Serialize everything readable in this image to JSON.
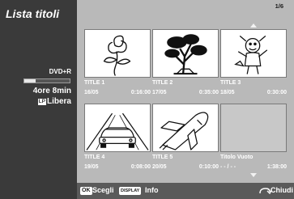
{
  "sidebar": {
    "title": "Lista titoli",
    "disc_type": "DVD+R",
    "space_used_fraction": 0.25,
    "time_remaining": "4ore 8min",
    "mode_badge": "LP",
    "mode_label": "Libera"
  },
  "main": {
    "page_counter": "1/6",
    "titles": [
      {
        "name": "TITLE 1",
        "date": "16/05",
        "duration": "0:16:00",
        "thumbnail": "rose-drawing"
      },
      {
        "name": "TITLE 2",
        "date": "17/05",
        "duration": "0:35:00",
        "thumbnail": "tree-drawing"
      },
      {
        "name": "TITLE 3",
        "date": "18/05",
        "duration": "0:30:00",
        "thumbnail": "cartoon-character-drawing"
      },
      {
        "name": "TITLE 4",
        "date": "19/05",
        "duration": "0:08:00",
        "thumbnail": "car-on-road-drawing"
      },
      {
        "name": "TITLE 5",
        "date": "20/05",
        "duration": "0:10:00",
        "thumbnail": "space-shuttle-drawing"
      },
      {
        "name": "Titolo Vuoto",
        "date": "- - / - -",
        "duration": "1:38:00",
        "thumbnail": "empty"
      }
    ]
  },
  "footer": {
    "ok_key": "OK",
    "select_label": "Scegli",
    "display_key": "DISPLAY",
    "info_label": "Info",
    "return_icon": "return-arrow-icon",
    "close_label": "Chiudi"
  },
  "colors": {
    "sidebar_bg": "#3a3a3a",
    "main_bg": "#b9b9b9",
    "footer_bg": "#5a5a5a",
    "text": "#ffffff"
  }
}
